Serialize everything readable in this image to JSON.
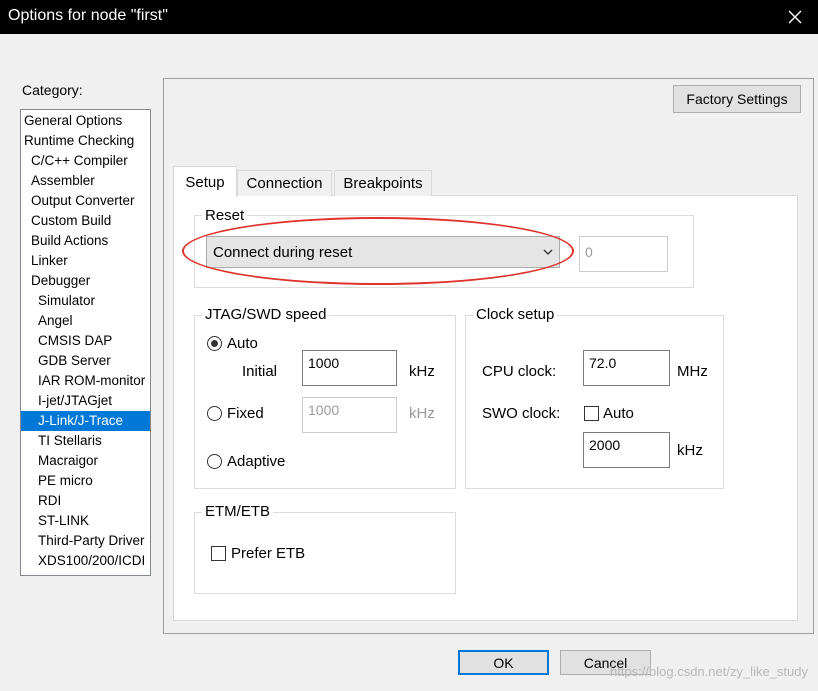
{
  "window": {
    "title": "Options for node \"first\""
  },
  "category": {
    "label": "Category:",
    "items": [
      "General Options",
      "Runtime Checking",
      "C/C++ Compiler",
      "Assembler",
      "Output Converter",
      "Custom Build",
      "Build Actions",
      "Linker",
      "Debugger",
      "Simulator",
      "Angel",
      "CMSIS DAP",
      "GDB Server",
      "IAR ROM-monitor",
      "I-jet/JTAGjet",
      "J-Link/J-Trace",
      "TI Stellaris",
      "Macraigor",
      "PE micro",
      "RDI",
      "ST-LINK",
      "Third-Party Driver",
      "XDS100/200/ICDI"
    ],
    "selected": "J-Link/J-Trace"
  },
  "factory_settings_label": "Factory Settings",
  "tabs": [
    {
      "label": "Setup"
    },
    {
      "label": "Connection"
    },
    {
      "label": "Breakpoints"
    }
  ],
  "active_tab": "Setup",
  "reset": {
    "label": "Reset",
    "selected": "Connect during reset",
    "delay_value": "0"
  },
  "jtag": {
    "label": "JTAG/SWD speed",
    "auto_label": "Auto",
    "initial_label": "Initial",
    "initial_value": "1000",
    "initial_unit": "kHz",
    "fixed_label": "Fixed",
    "fixed_value": "1000",
    "fixed_unit": "kHz",
    "adaptive_label": "Adaptive",
    "selected": "Auto"
  },
  "clock": {
    "label": "Clock setup",
    "cpu_label": "CPU clock:",
    "cpu_value": "72.0",
    "cpu_unit": "MHz",
    "swo_label": "SWO clock:",
    "swo_auto_label": "Auto",
    "swo_auto_checked": false,
    "swo_value": "2000",
    "swo_unit": "kHz"
  },
  "etm": {
    "label": "ETM/ETB",
    "prefer_label": "Prefer ETB",
    "prefer_checked": false
  },
  "buttons": {
    "ok": "OK",
    "cancel": "Cancel"
  },
  "watermark": "https://blog.csdn.net/zy_like_study",
  "colors": {
    "selection": "#0078d7",
    "annotation": "#e0332b",
    "titlebar": "#000000"
  }
}
